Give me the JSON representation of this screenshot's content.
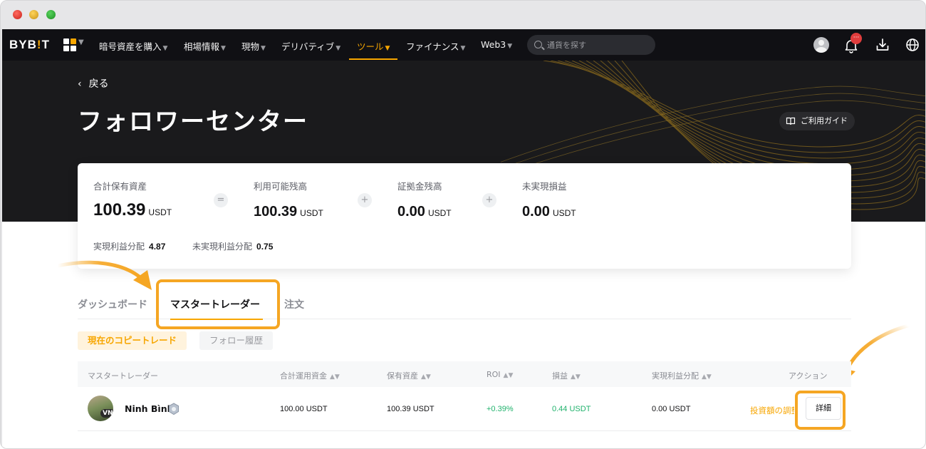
{
  "nav": {
    "logo_left": "BYB",
    "logo_bang": "!",
    "logo_right": "T",
    "items": [
      {
        "label": "暗号資産を購入"
      },
      {
        "label": "相場情報"
      },
      {
        "label": "現物"
      },
      {
        "label": "デリバティブ"
      },
      {
        "label": "ツール"
      },
      {
        "label": "ファイナンス"
      },
      {
        "label": "Web3"
      }
    ],
    "search_placeholder": "通貨を探す",
    "notification_badge": "···",
    "colors": {
      "accent": "#f7a600",
      "background": "#101014"
    }
  },
  "hero": {
    "back_label": "戻る",
    "title": "フォロワーセンター",
    "guide_label": "ご利用ガイド"
  },
  "summary": {
    "total": {
      "label": "合計保有資産",
      "value": "100.39",
      "unit": "USDT"
    },
    "available": {
      "label": "利用可能残高",
      "value": "100.39",
      "unit": "USDT"
    },
    "margin": {
      "label": "証拠金残高",
      "value": "0.00",
      "unit": "USDT"
    },
    "unrealized": {
      "label": "未実現損益",
      "value": "0.00",
      "unit": "USDT"
    },
    "ops": [
      "=",
      "+",
      "+"
    ],
    "realized_share_label": "実現利益分配",
    "realized_share_value": "4.87",
    "unrealized_share_label": "未実現利益分配",
    "unrealized_share_value": "0.75"
  },
  "tabs": [
    {
      "label": "ダッシュボード"
    },
    {
      "label": "マスタートレーダー"
    },
    {
      "label": "注文"
    }
  ],
  "subtabs": {
    "active": "現在のコピートレード",
    "inactive": "フォロー履歴"
  },
  "table": {
    "headers": {
      "trader": "マスタートレーダー",
      "total_invest": "合計運用資金",
      "holding": "保有資産",
      "roi": "ROI",
      "pnl": "損益",
      "realized_share": "実現利益分配",
      "action": "アクション"
    },
    "rows": [
      {
        "avatar_tag": "VN",
        "name": "Ninh Bình",
        "total_invest": "100.00 USDT",
        "holding": "100.39 USDT",
        "roi": "+0.39%",
        "pnl": "0.44 USDT",
        "realized_share": "0.00 USDT",
        "action_link": "投資額の調整",
        "detail": "詳細"
      }
    ]
  }
}
